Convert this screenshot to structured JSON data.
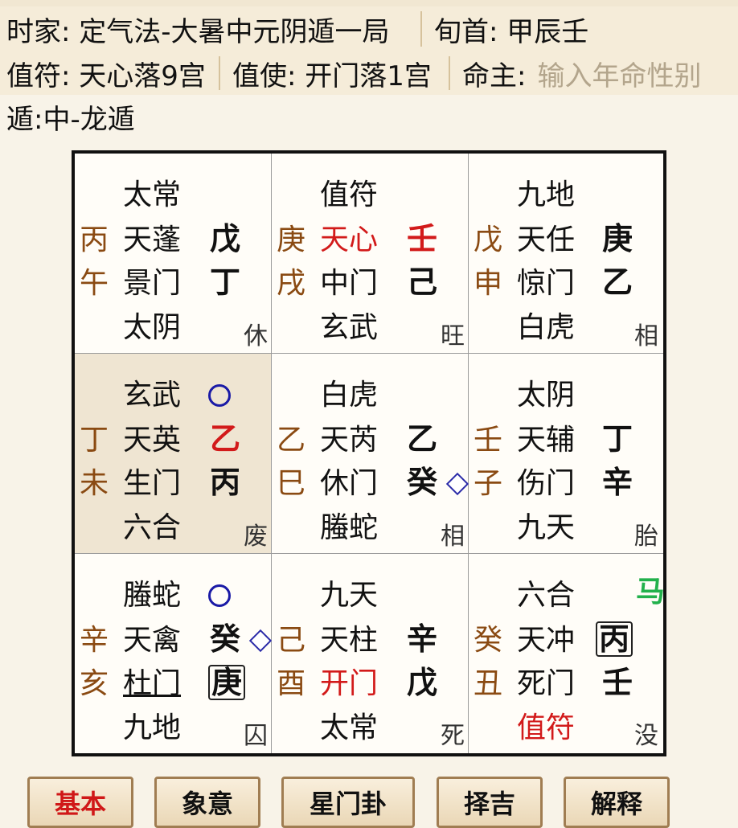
{
  "header": {
    "shijia": "时家: 定气法-大暑中元阴遁一局",
    "xunshou": "旬首: 甲辰壬",
    "zhifu": "值符: 天心落9宫",
    "zhishi": "值使: 开门落1宫",
    "mingzhu_label": "命主:",
    "mingzhu_placeholder": "输入年命性别",
    "dun": "遁:中-龙遁"
  },
  "palaces": [
    {
      "god": "太常",
      "star": "天蓬",
      "door": "景门",
      "deity": "太阴",
      "heaven_stem": "戊",
      "earth_stem": "丁",
      "left_top": "丙",
      "left_bottom": "午",
      "state": "休"
    },
    {
      "god": "值符",
      "star": "天心",
      "door": "中门",
      "deity": "玄武",
      "heaven_stem": "壬",
      "earth_stem": "己",
      "left_top": "庚",
      "left_bottom": "戌",
      "state": "旺"
    },
    {
      "god": "九地",
      "star": "天任",
      "door": "惊门",
      "deity": "白虎",
      "heaven_stem": "庚",
      "earth_stem": "乙",
      "left_top": "戊",
      "left_bottom": "申",
      "state": "相"
    },
    {
      "god": "玄武",
      "star": "天英",
      "door": "生门",
      "deity": "六合",
      "heaven_stem": "乙",
      "earth_stem": "丙",
      "left_top": "丁",
      "left_bottom": "未",
      "state": "废"
    },
    {
      "god": "白虎",
      "star": "天芮",
      "door": "休门",
      "deity": "螣蛇",
      "heaven_stem": "乙",
      "earth_stem": "癸",
      "left_top": "乙",
      "left_bottom": "巳",
      "state": "相"
    },
    {
      "god": "太阴",
      "star": "天辅",
      "door": "伤门",
      "deity": "九天",
      "heaven_stem": "丁",
      "earth_stem": "辛",
      "left_top": "壬",
      "left_bottom": "子",
      "state": "胎"
    },
    {
      "god": "螣蛇",
      "star": "天禽",
      "door": "杜门",
      "deity": "九地",
      "heaven_stem": "癸",
      "earth_stem": "庚",
      "left_top": "辛",
      "left_bottom": "亥",
      "state": "囚"
    },
    {
      "god": "九天",
      "star": "天柱",
      "door": "开门",
      "deity": "太常",
      "heaven_stem": "辛",
      "earth_stem": "戊",
      "left_top": "己",
      "left_bottom": "酉",
      "state": "死"
    },
    {
      "god": "六合",
      "star": "天冲",
      "door": "死门",
      "deity": "值符",
      "heaven_stem": "丙",
      "earth_stem": "壬",
      "left_top": "癸",
      "left_bottom": "丑",
      "state": "没",
      "horse": "马"
    }
  ],
  "tabs": [
    "基本",
    "象意",
    "星门卦",
    "择吉",
    "解释"
  ],
  "colors": {
    "red": "#d21a1a",
    "brown": "#8a4a12",
    "green": "#22b14c",
    "circle": "#1a1aa6"
  }
}
